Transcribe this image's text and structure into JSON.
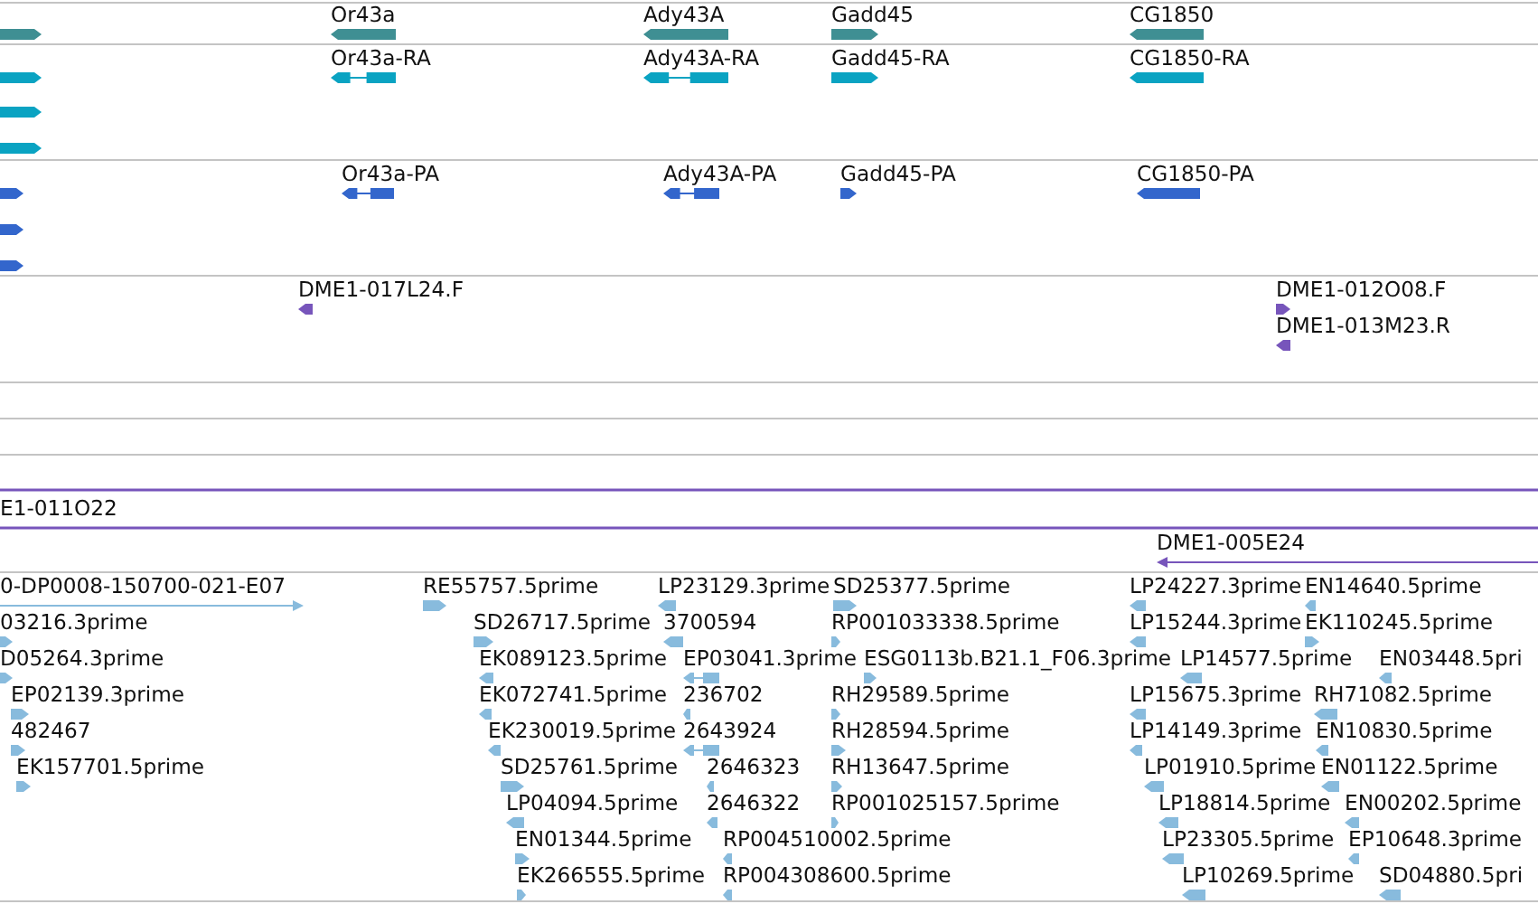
{
  "tracks": [
    {
      "kind": "gene",
      "features": [
        {
          "kind": "block",
          "reverse": false
        },
        {
          "label": "Or43a",
          "kind": "block",
          "reverse": true
        },
        {
          "label": "Ady43A",
          "kind": "block",
          "reverse": true
        },
        {
          "label": "Gadd45",
          "kind": "block",
          "reverse": false
        },
        {
          "label": "CG1850",
          "kind": "block",
          "reverse": true
        }
      ]
    },
    {
      "kind": "transcript",
      "features": [
        {
          "kind": "block",
          "reverse": false
        },
        {
          "label": "Or43a-RA",
          "kind": "split",
          "reverse": true
        },
        {
          "label": "Ady43A-RA",
          "kind": "split",
          "reverse": true
        },
        {
          "label": "Gadd45-RA",
          "kind": "block",
          "reverse": false
        },
        {
          "label": "CG1850-RA",
          "kind": "block",
          "reverse": true
        },
        {
          "kind": "block",
          "reverse": false
        },
        {
          "kind": "block",
          "reverse": false
        }
      ]
    },
    {
      "kind": "protein",
      "features": [
        {
          "kind": "block",
          "reverse": false
        },
        {
          "label": "Or43a-PA",
          "kind": "split",
          "reverse": true
        },
        {
          "label": "Ady43A-PA",
          "kind": "split",
          "reverse": true
        },
        {
          "label": "Gadd45-PA",
          "kind": "block",
          "reverse": false
        },
        {
          "label": "CG1850-PA",
          "kind": "block",
          "reverse": true
        },
        {
          "kind": "block",
          "reverse": false
        },
        {
          "kind": "block",
          "reverse": false
        }
      ]
    },
    {
      "kind": "bac",
      "features": [
        {
          "label": "DME1-017L24.F",
          "kind": "block",
          "reverse": true
        },
        {
          "label": "DME1-012O08.F",
          "kind": "block",
          "reverse": false
        },
        {
          "label": "DME1-013M23.R",
          "kind": "block",
          "reverse": true
        }
      ]
    },
    {
      "kind": "bac",
      "features": [
        {
          "kind": "line"
        },
        {
          "label": "E1-011O22",
          "kind": "line"
        },
        {
          "label": "DME1-005E24",
          "kind": "thin",
          "reverse": true
        }
      ]
    },
    {
      "kind": "est",
      "features": [
        {
          "label": "0-DP0008-150700-021-E07",
          "kind": "thin",
          "reverse": false
        },
        {
          "label": "RE55757.5prime",
          "kind": "block",
          "reverse": false
        },
        {
          "label": "LP23129.3prime",
          "kind": "block",
          "reverse": true
        },
        {
          "label": "SD25377.5prime",
          "kind": "block",
          "reverse": false
        },
        {
          "label": "LP24227.3prime",
          "kind": "block",
          "reverse": true
        },
        {
          "label": "EN14640.5prime",
          "kind": "block",
          "reverse": true
        },
        {
          "label": "03216.3prime",
          "kind": "block",
          "reverse": false
        },
        {
          "label": "SD26717.5prime",
          "kind": "block",
          "reverse": false
        },
        {
          "label": "3700594",
          "kind": "block",
          "reverse": true
        },
        {
          "label": "RP001033338.5prime",
          "kind": "block",
          "reverse": false
        },
        {
          "label": "LP15244.3prime",
          "kind": "block",
          "reverse": true
        },
        {
          "label": "EK110245.5prime",
          "kind": "block",
          "reverse": false
        },
        {
          "label": "D05264.3prime",
          "kind": "block",
          "reverse": false
        },
        {
          "label": "EK089123.5prime",
          "kind": "block",
          "reverse": true
        },
        {
          "label": "EP03041.3prime",
          "kind": "split",
          "reverse": true
        },
        {
          "label": "ESG0113b.B21.1_F06.3prime",
          "kind": "block",
          "reverse": false
        },
        {
          "label": "LP14577.5prime",
          "kind": "block",
          "reverse": true
        },
        {
          "label": "EN03448.5pri",
          "kind": "block",
          "reverse": true
        },
        {
          "label": "EP02139.3prime",
          "kind": "block",
          "reverse": false
        },
        {
          "label": "EK072741.5prime",
          "kind": "block",
          "reverse": true
        },
        {
          "label": "236702",
          "kind": "block",
          "reverse": true
        },
        {
          "label": "RH29589.5prime",
          "kind": "block",
          "reverse": false
        },
        {
          "label": "LP15675.3prime",
          "kind": "block",
          "reverse": true
        },
        {
          "label": "RH71082.5prime",
          "kind": "block",
          "reverse": true
        },
        {
          "label": "482467",
          "kind": "block",
          "reverse": false
        },
        {
          "label": "EK230019.5prime",
          "kind": "block",
          "reverse": true
        },
        {
          "label": "2643924",
          "kind": "split",
          "reverse": true
        },
        {
          "label": "RH28594.5prime",
          "kind": "block",
          "reverse": false
        },
        {
          "label": "LP14149.3prime",
          "kind": "block",
          "reverse": true
        },
        {
          "label": "EN10830.5prime",
          "kind": "block",
          "reverse": true
        },
        {
          "label": "EK157701.5prime",
          "kind": "block",
          "reverse": false
        },
        {
          "label": "SD25761.5prime",
          "kind": "block",
          "reverse": false
        },
        {
          "label": "2646323",
          "kind": "block",
          "reverse": true
        },
        {
          "label": "RH13647.5prime",
          "kind": "block",
          "reverse": false
        },
        {
          "label": "LP01910.5prime",
          "kind": "block",
          "reverse": true
        },
        {
          "label": "EN01122.5prime",
          "kind": "block",
          "reverse": true
        },
        {
          "label": "LP04094.5prime",
          "kind": "block",
          "reverse": true
        },
        {
          "label": "2646322",
          "kind": "block",
          "reverse": true
        },
        {
          "label": "RP001025157.5prime",
          "kind": "block",
          "reverse": false
        },
        {
          "label": "LP18814.5prime",
          "kind": "block",
          "reverse": true
        },
        {
          "label": "EN00202.5prime",
          "kind": "block",
          "reverse": true
        },
        {
          "label": "EN01344.5prime",
          "kind": "block",
          "reverse": false
        },
        {
          "label": "RP004510002.5prime",
          "kind": "block",
          "reverse": true
        },
        {
          "label": "LP23305.5prime",
          "kind": "block",
          "reverse": true
        },
        {
          "label": "EP10648.3prime",
          "kind": "block",
          "reverse": true
        },
        {
          "label": "EK266555.5prime",
          "kind": "block",
          "reverse": false
        },
        {
          "label": "RP004308600.5prime",
          "kind": "block",
          "reverse": true
        },
        {
          "label": "LP10269.5prime",
          "kind": "block",
          "reverse": true
        },
        {
          "label": "SD04880.5pri",
          "kind": "block",
          "reverse": true
        }
      ]
    }
  ]
}
